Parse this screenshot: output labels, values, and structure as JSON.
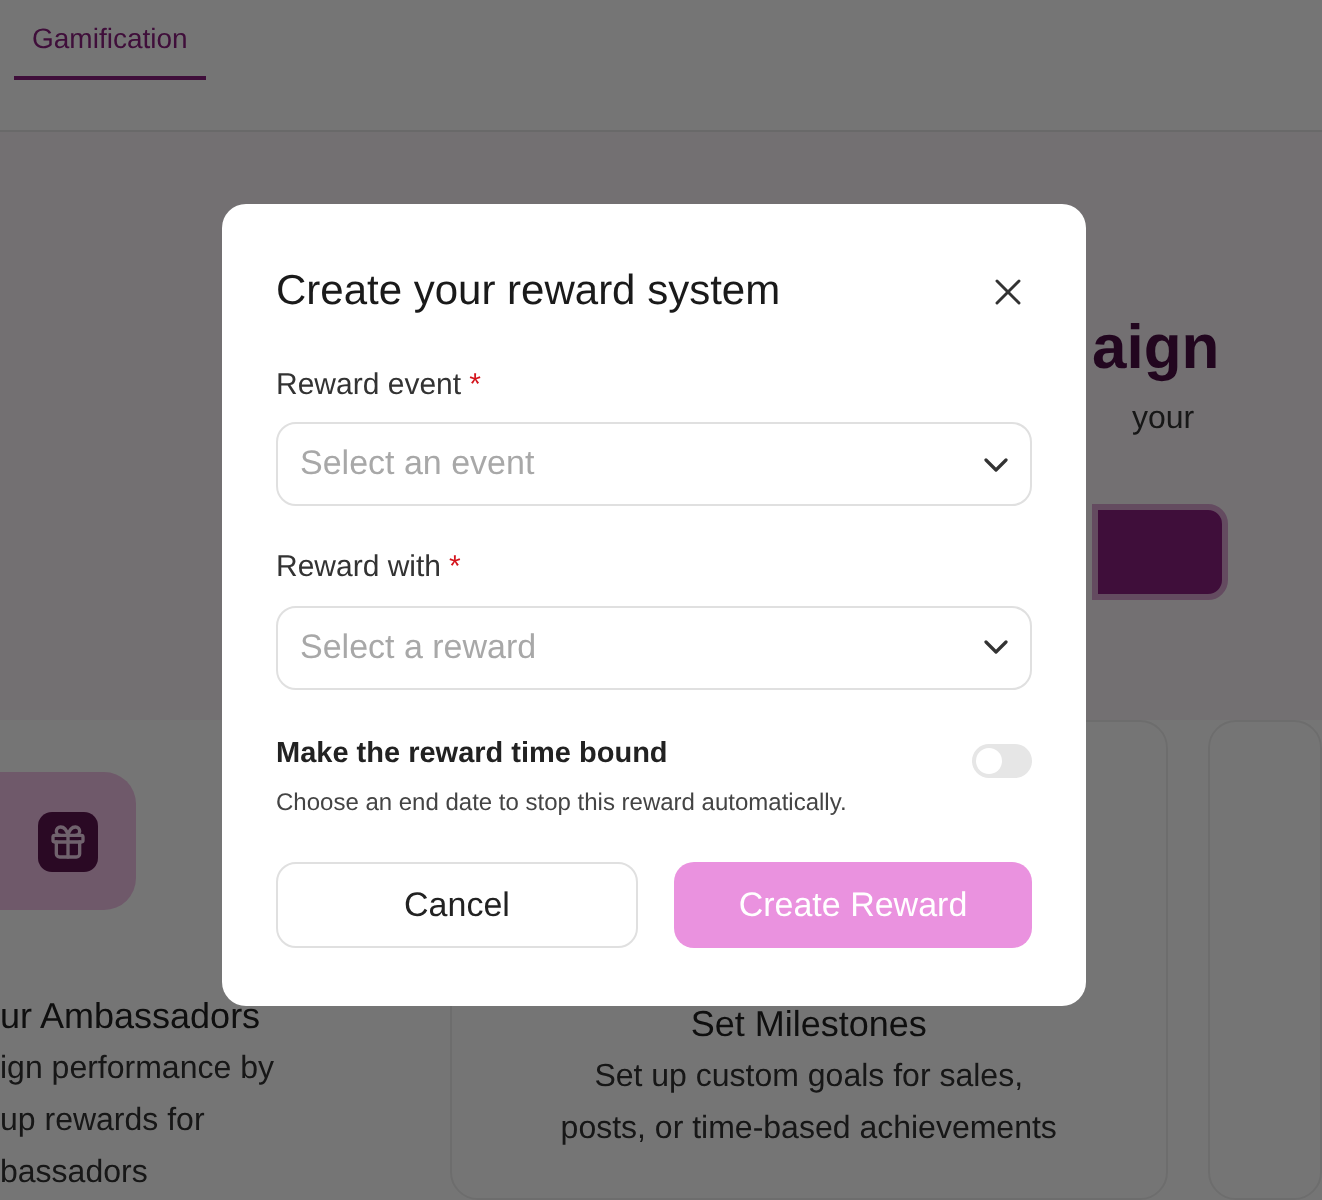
{
  "tabs": [
    {
      "label": "Gamification",
      "selected": true
    }
  ],
  "hero": {
    "title": "aign",
    "subtitle": "your"
  },
  "cards": [
    {
      "title": "ur Ambassadors",
      "lines": [
        "ign performance by",
        "up rewards for",
        "bassadors"
      ]
    },
    {
      "title": "Set Milestones",
      "lines": [
        "Set up custom goals for sales,",
        "posts, or time-based achievements"
      ]
    }
  ],
  "dialog": {
    "title": "Create your reward system",
    "fields": [
      {
        "label": "Reward event",
        "required_mark": "*",
        "placeholder": "Select an event"
      },
      {
        "label": "Reward with",
        "required_mark": "*",
        "placeholder": "Select a reward"
      }
    ],
    "toggle": {
      "label": "Make the reward time bound",
      "description": "Choose an end date to stop this reward automatically.",
      "on": false
    },
    "buttons": [
      {
        "label": "Cancel",
        "kind": "secondary",
        "disabled": false
      },
      {
        "label": "Create Reward",
        "kind": "primary",
        "disabled": true
      }
    ]
  }
}
